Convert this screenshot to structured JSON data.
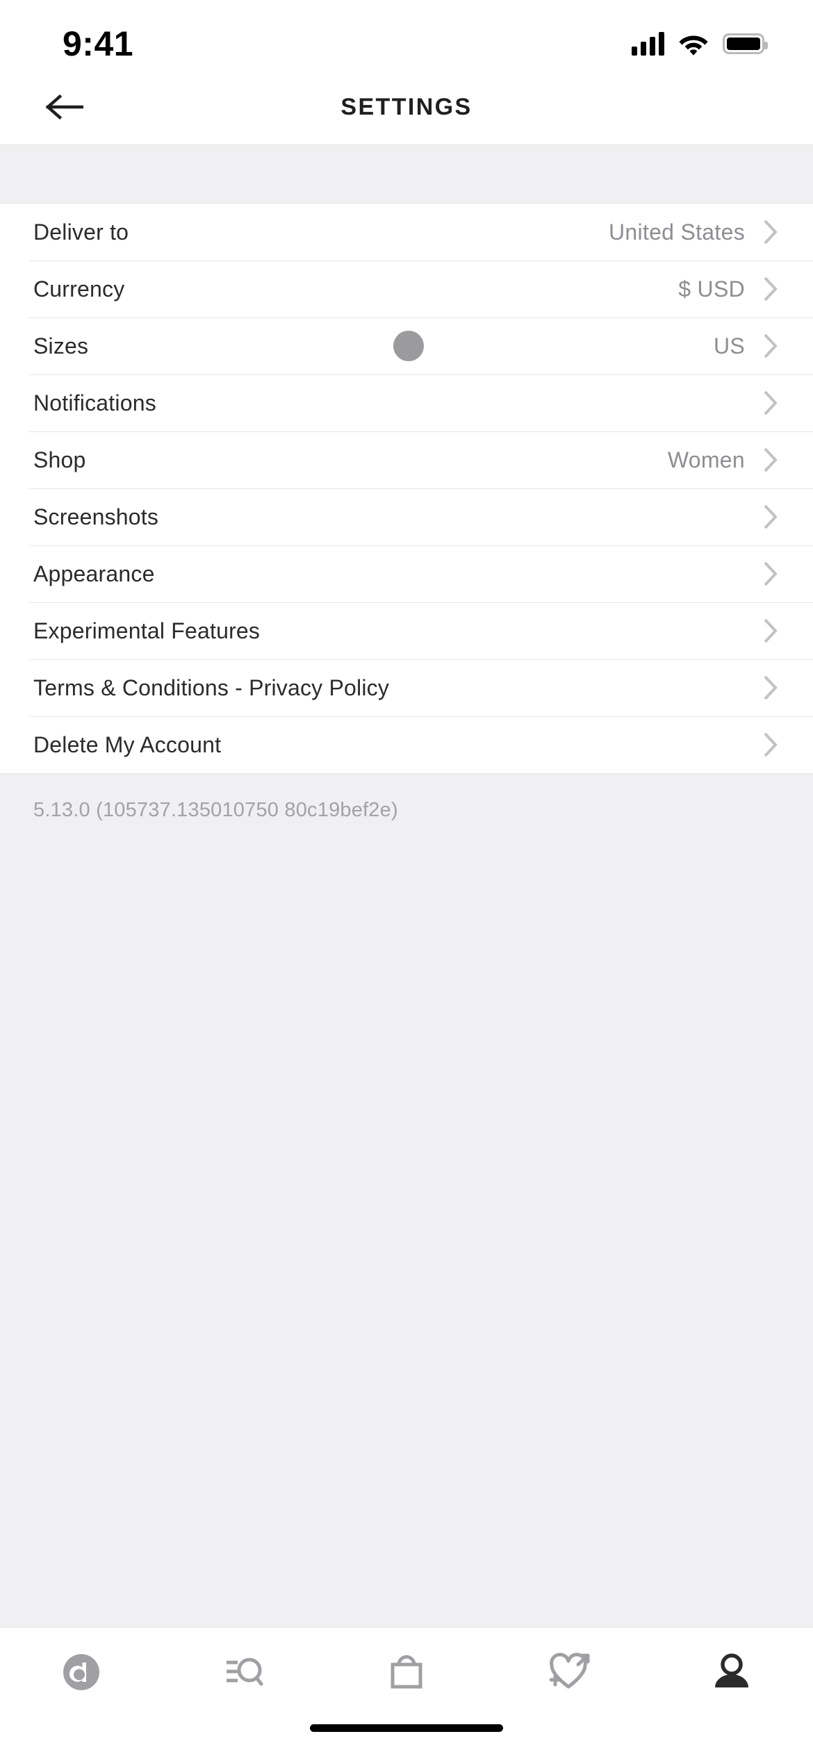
{
  "status_bar": {
    "time": "9:41",
    "cellular_icon": "signal-bars-icon",
    "wifi_icon": "wifi-icon",
    "battery_icon": "battery-full-icon"
  },
  "nav": {
    "back_icon": "back-arrow-icon",
    "title": "SETTINGS"
  },
  "settings_rows": [
    {
      "label": "Deliver to",
      "value": "United States",
      "chevron": "chevron-right-icon",
      "dot": false
    },
    {
      "label": "Currency",
      "value": "$ USD",
      "chevron": "chevron-right-icon",
      "dot": false
    },
    {
      "label": "Sizes",
      "value": "US",
      "chevron": "chevron-right-icon",
      "dot": true
    },
    {
      "label": "Notifications",
      "value": "",
      "chevron": "chevron-right-icon",
      "dot": false
    },
    {
      "label": "Shop",
      "value": "Women",
      "chevron": "chevron-right-icon",
      "dot": false
    },
    {
      "label": "Screenshots",
      "value": "",
      "chevron": "chevron-right-icon",
      "dot": false
    },
    {
      "label": "Appearance",
      "value": "",
      "chevron": "chevron-right-icon",
      "dot": false
    },
    {
      "label": "Experimental Features",
      "value": "",
      "chevron": "chevron-right-icon",
      "dot": false
    },
    {
      "label": "Terms & Conditions - Privacy Policy",
      "value": "",
      "chevron": "chevron-right-icon",
      "dot": false
    },
    {
      "label": "Delete My Account",
      "value": "",
      "chevron": "chevron-right-icon",
      "dot": false
    }
  ],
  "version": "5.13.0 (105737.135010750 80c19bef2e)",
  "tab_bar": {
    "items": [
      {
        "icon": "brand-a-logo-icon",
        "active": false
      },
      {
        "icon": "browse-search-icon",
        "active": false
      },
      {
        "icon": "shopping-bag-icon",
        "active": false
      },
      {
        "icon": "heart-gender-icon",
        "active": false
      },
      {
        "icon": "profile-person-icon",
        "active": true
      }
    ]
  },
  "colors": {
    "background": "#ffffff",
    "band": "#f0eff1",
    "label": "#2b2b2b",
    "value": "#8d8d93",
    "divider": "#e6e5e8",
    "inactive_icon": "#a0a0a4",
    "active_icon": "#2b2b2b",
    "size_dot": "#9b9b9e"
  }
}
